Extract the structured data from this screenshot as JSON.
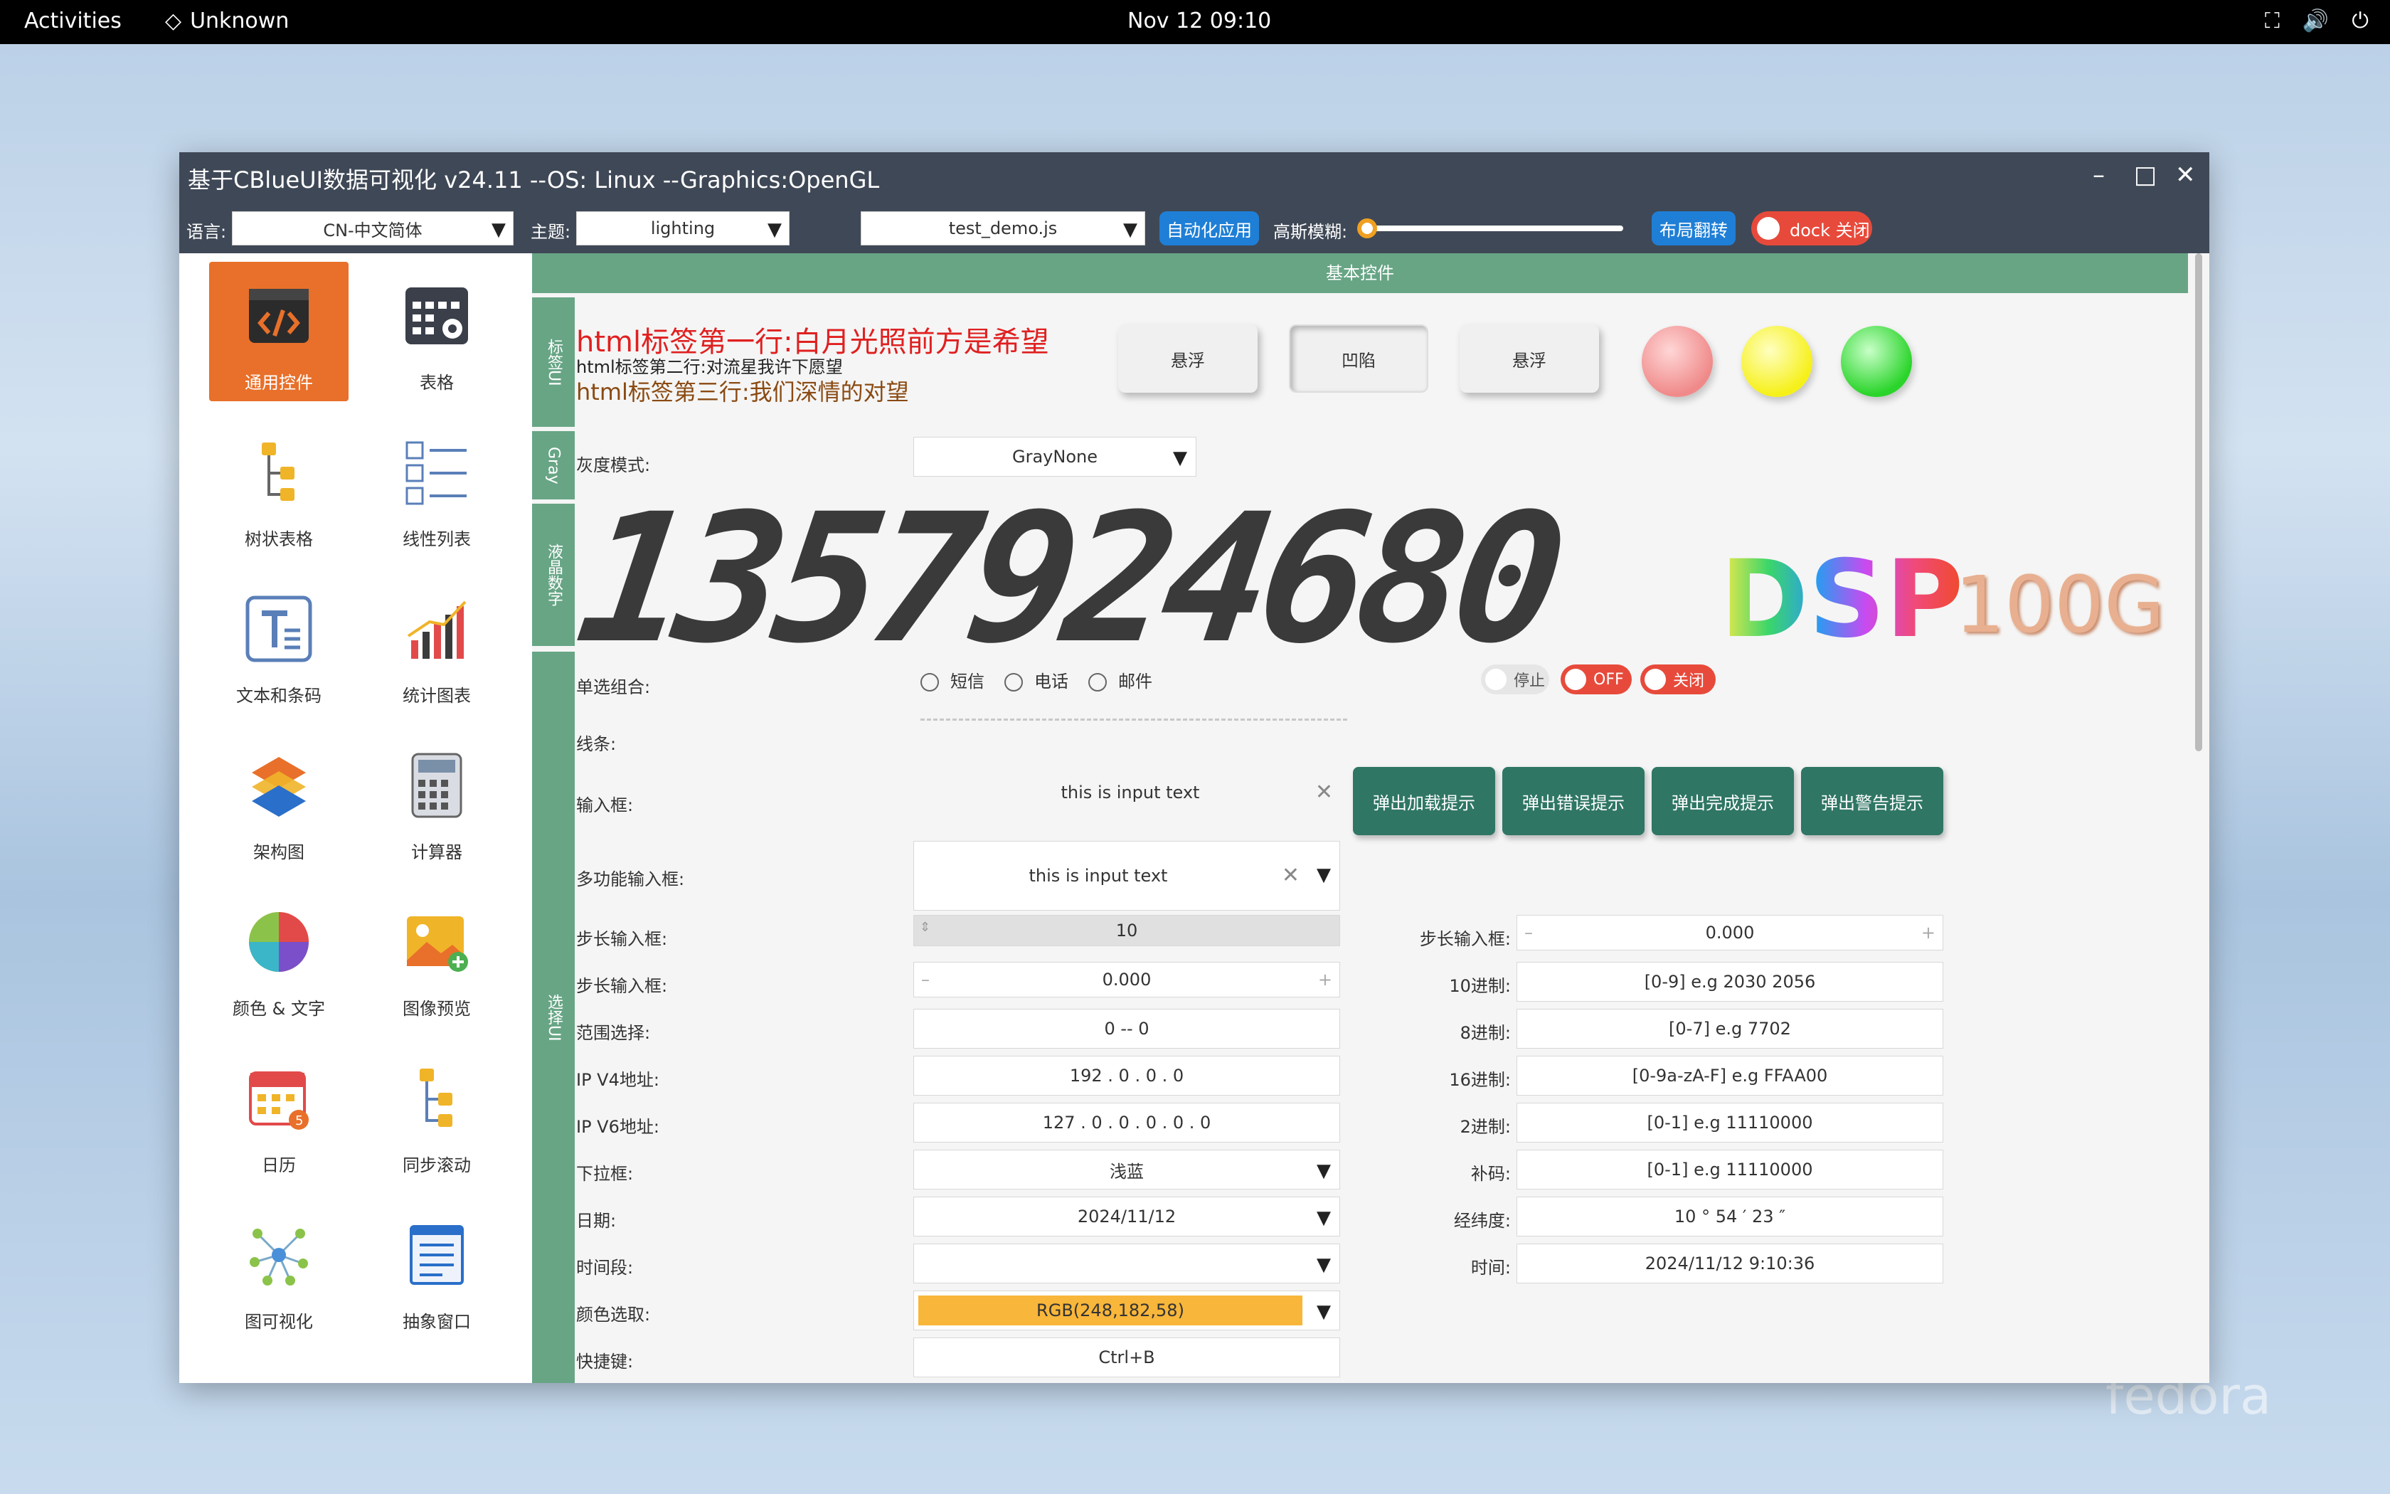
{
  "topbar": {
    "activities": "Activities",
    "app_name": "Unknown",
    "clock": "Nov 12  09:10"
  },
  "window": {
    "title": "基于CBlueUI数据可视化  v24.11  --OS: Linux  --Graphics:OpenGL"
  },
  "toolbar": {
    "lang_label": "语言:",
    "lang_value": "CN-中文简体",
    "theme_label": "主题:",
    "theme_value": "lighting",
    "script_value": "test_demo.js",
    "auto_btn": "自动化应用",
    "blur_label": "高斯模糊:",
    "layout_btn": "布局翻转",
    "dock_btn": "dock 关闭"
  },
  "sidebar": {
    "items": [
      {
        "label": "通用控件"
      },
      {
        "label": "表格"
      },
      {
        "label": "树状表格"
      },
      {
        "label": "线性列表"
      },
      {
        "label": "文本和条码"
      },
      {
        "label": "统计图表"
      },
      {
        "label": "架构图"
      },
      {
        "label": "计算器"
      },
      {
        "label": "颜色 & 文字"
      },
      {
        "label": "图像预览"
      },
      {
        "label": "日历"
      },
      {
        "label": "同步滚动"
      },
      {
        "label": "图可视化"
      },
      {
        "label": "抽象窗口"
      }
    ]
  },
  "content": {
    "header": "基本控件",
    "tabs": {
      "label_ui": "标签UI",
      "gray": "Gray",
      "lcd": "液晶数字",
      "select_ui": "选择UI"
    },
    "html_lines": [
      "html标签第一行:白月光照前方是希望",
      "html标签第二行:对流星我许下愿望",
      "html标签第三行:我们深情的对望"
    ],
    "buttons": {
      "float1": "悬浮",
      "sunk": "凹陷",
      "float2": "悬浮"
    },
    "gray_label": "灰度模式:",
    "gray_value": "GrayNone",
    "lcd_digits": "1357924680",
    "dsp": {
      "text": "DSP",
      "sub": "100G"
    },
    "radio": {
      "label": "单选组合:",
      "opts": [
        "短信",
        "电话",
        "邮件"
      ]
    },
    "toggles": {
      "stop": "停止",
      "off": "OFF",
      "close": "关闭"
    },
    "line_label": "线条:",
    "input": {
      "label": "输入框:",
      "value": "this is input text"
    },
    "popup_btns": [
      "弹出加载提示",
      "弹出错误提示",
      "弹出完成提示",
      "弹出警告提示"
    ],
    "multi": {
      "label": "多功能输入框:",
      "value": "this is input text"
    },
    "left_rows": [
      {
        "label": "步长输入框:",
        "value": "10"
      },
      {
        "label": "步长输入框:",
        "value": "0.000"
      },
      {
        "label": "范围选择:",
        "value": "0 -- 0"
      },
      {
        "label": "IP V4地址:",
        "value": "192 . 0 . 0 . 0"
      },
      {
        "label": "IP V6地址:",
        "value": "127 . 0 . 0 . 0 . 0 . 0"
      },
      {
        "label": "下拉框:",
        "value": "浅蓝"
      },
      {
        "label": "日期:",
        "value": "2024/11/12"
      },
      {
        "label": "时间段:",
        "value": ""
      },
      {
        "label": "颜色选取:",
        "value": "RGB(248,182,58)"
      },
      {
        "label": "快捷键:",
        "value": "Ctrl+B"
      }
    ],
    "right_rows": [
      {
        "label": "步长输入框:",
        "value": "0.000"
      },
      {
        "label": "10进制:",
        "value": "[0-9] e.g 2030 2056"
      },
      {
        "label": "8进制:",
        "value": "[0-7] e.g 7702"
      },
      {
        "label": "16进制:",
        "value": "[0-9a-zA-F] e.g FFAA00"
      },
      {
        "label": "2进制:",
        "value": "[0-1] e.g 11110000"
      },
      {
        "label": "补码:",
        "value": "[0-1] e.g 11110000"
      },
      {
        "label": "经纬度:",
        "value": "10 °   54 ′   23 ″"
      },
      {
        "label": "时间:",
        "value": "2024/11/12   9:10:36"
      }
    ]
  },
  "colors": {
    "accent_green": "#67a585",
    "orange": "#e8702a",
    "picked": "#f8b63a"
  },
  "watermark": "fedora"
}
